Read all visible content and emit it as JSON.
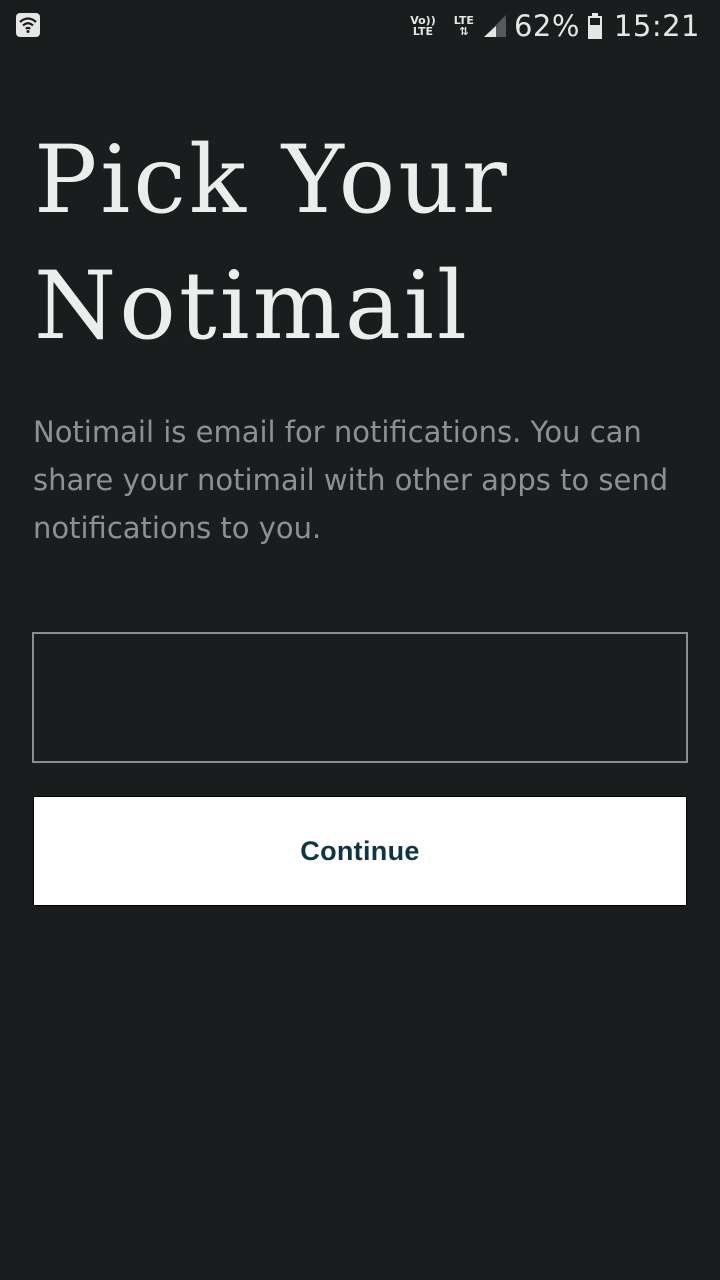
{
  "status_bar": {
    "volte_top": "Vo))",
    "volte_bottom": "LTE",
    "lte_top": "LTE",
    "lte_bottom": "⇅",
    "battery_percent": "62%",
    "time": "15:21"
  },
  "main": {
    "title": "Pick Your Notimail",
    "description": "Notimail is email for notifications. You can share your notimail with other apps to send notifications to you.",
    "input_value": "",
    "continue_label": "Continue"
  },
  "colors": {
    "background": "#1a1d1e",
    "title": "#eceded",
    "description": "#8e9191",
    "button_bg": "#ffffff",
    "button_text": "#0f3640"
  }
}
